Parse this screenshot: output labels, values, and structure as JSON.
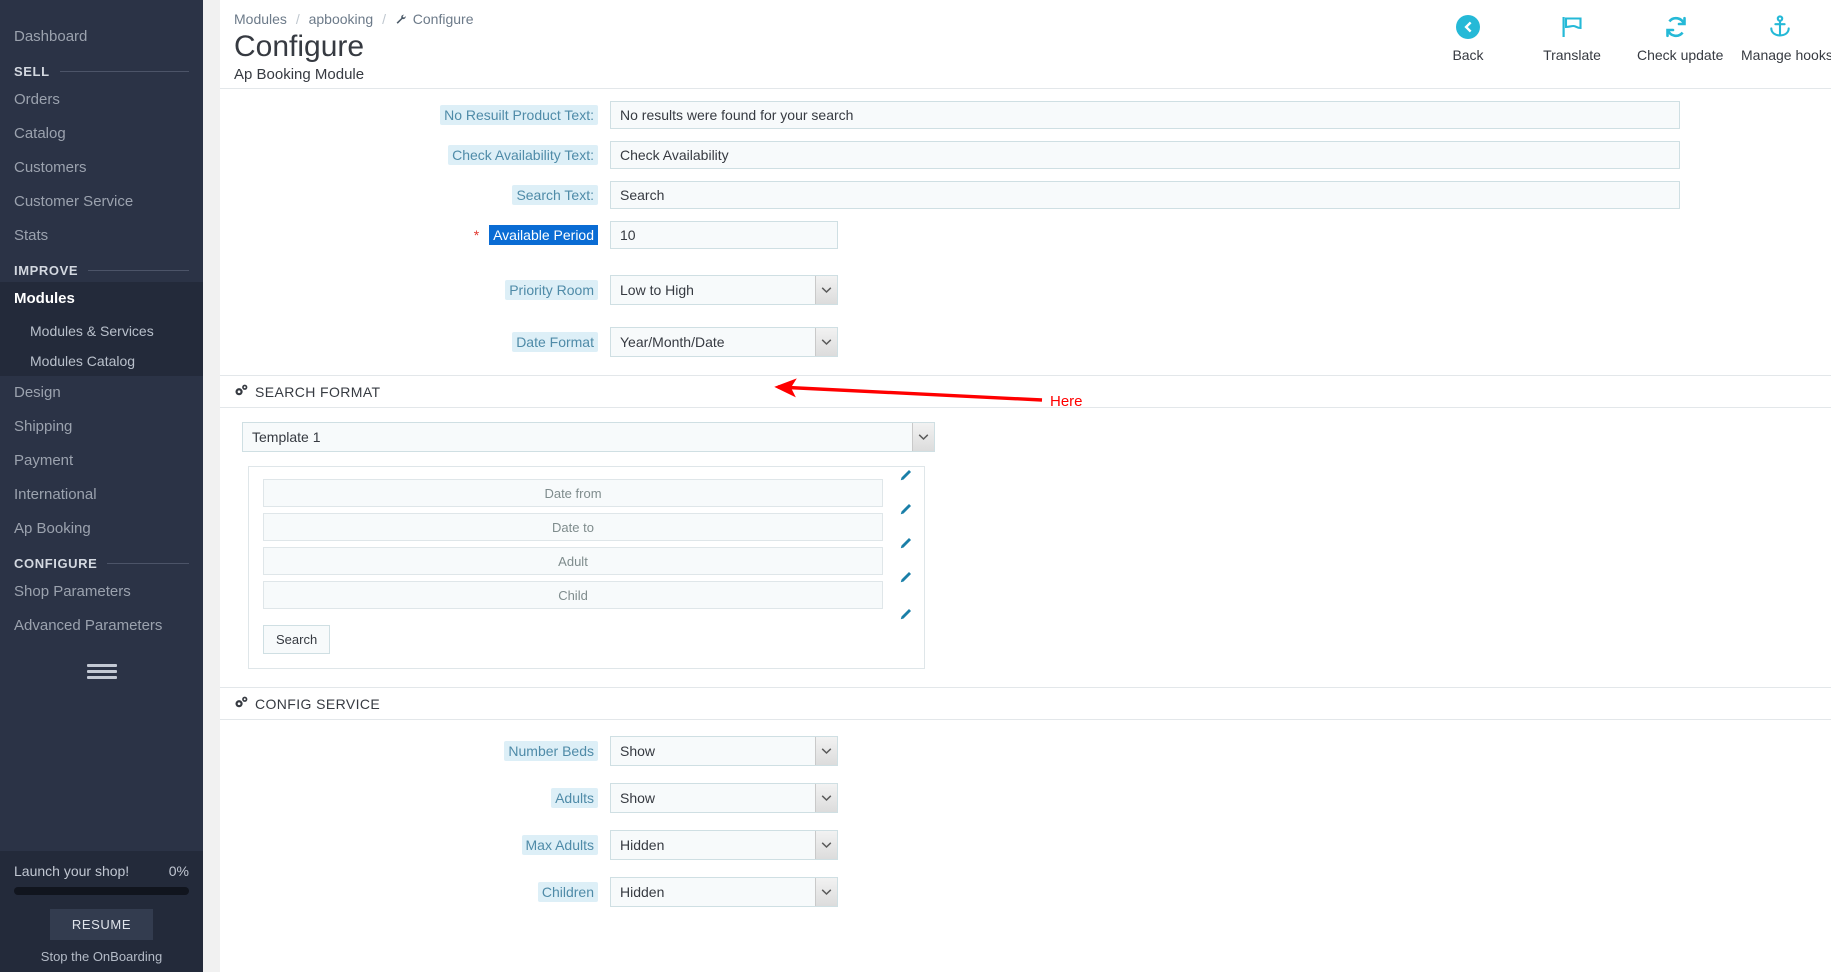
{
  "sidebar": {
    "dashboard": {
      "label": "Dashboard"
    },
    "sections": [
      {
        "title": "SELL",
        "items": [
          {
            "label": "Orders"
          },
          {
            "label": "Catalog"
          },
          {
            "label": "Customers"
          },
          {
            "label": "Customer Service"
          },
          {
            "label": "Stats"
          }
        ]
      },
      {
        "title": "IMPROVE",
        "items": [
          {
            "label": "Modules",
            "active": true,
            "children": [
              {
                "label": "Modules & Services"
              },
              {
                "label": "Modules Catalog"
              }
            ]
          },
          {
            "label": "Design"
          },
          {
            "label": "Shipping"
          },
          {
            "label": "Payment"
          },
          {
            "label": "International"
          },
          {
            "label": "Ap Booking"
          }
        ]
      },
      {
        "title": "CONFIGURE",
        "items": [
          {
            "label": "Shop Parameters"
          },
          {
            "label": "Advanced Parameters"
          }
        ]
      }
    ],
    "onboarding": {
      "title": "Launch your shop!",
      "percent": "0%",
      "progress_value": 0,
      "resume_label": "RESUME",
      "stop_label": "Stop the OnBoarding"
    }
  },
  "header": {
    "breadcrumb": [
      "Modules",
      "apbooking",
      "Configure"
    ],
    "title": "Configure",
    "subtitle": "Ap Booking Module",
    "toolbar": [
      {
        "label": "Back",
        "icon": "back-circle-arrow-icon"
      },
      {
        "label": "Translate",
        "icon": "flag-icon"
      },
      {
        "label": "Check update",
        "icon": "refresh-icon"
      },
      {
        "label": "Manage hooks",
        "icon": "anchor-icon"
      }
    ],
    "accent_color": "#25b9d7"
  },
  "settings_form": {
    "rows": [
      {
        "label": "No Resuilt Product Text:",
        "type": "text",
        "value": "No results were found for your search",
        "required": false,
        "selected": false,
        "width": "wide"
      },
      {
        "label": "Check Availability Text:",
        "type": "text",
        "value": "Check Availability",
        "required": false,
        "selected": false,
        "width": "wide"
      },
      {
        "label": "Search Text:",
        "type": "text",
        "value": "Search",
        "required": false,
        "selected": false,
        "width": "wide"
      },
      {
        "label": "Available Period",
        "type": "text",
        "value": "10",
        "required": true,
        "selected": true,
        "width": "small"
      },
      {
        "label": "Priority Room",
        "type": "select",
        "value": "Low to High",
        "required": false,
        "selected": false,
        "width": "small"
      },
      {
        "label": "Date Format",
        "type": "select",
        "value": "Year/Month/Date",
        "required": false,
        "selected": false,
        "width": "small"
      }
    ]
  },
  "search_format": {
    "panel_title": "SEARCH FORMAT",
    "template_select": "Template 1",
    "fields": [
      {
        "label": "Date from"
      },
      {
        "label": "Date to"
      },
      {
        "label": "Adult"
      },
      {
        "label": "Child"
      }
    ],
    "search_button": "Search",
    "edit_icon": "pencil-icon"
  },
  "config_service": {
    "panel_title": "CONFIG SERVICE",
    "rows": [
      {
        "label": "Number Beds",
        "value": "Show"
      },
      {
        "label": "Adults",
        "value": "Show"
      },
      {
        "label": "Max Adults",
        "value": "Hidden"
      },
      {
        "label": "Children",
        "value": "Hidden"
      }
    ]
  },
  "annotation": {
    "label": "Here",
    "color": "#ff0000"
  }
}
